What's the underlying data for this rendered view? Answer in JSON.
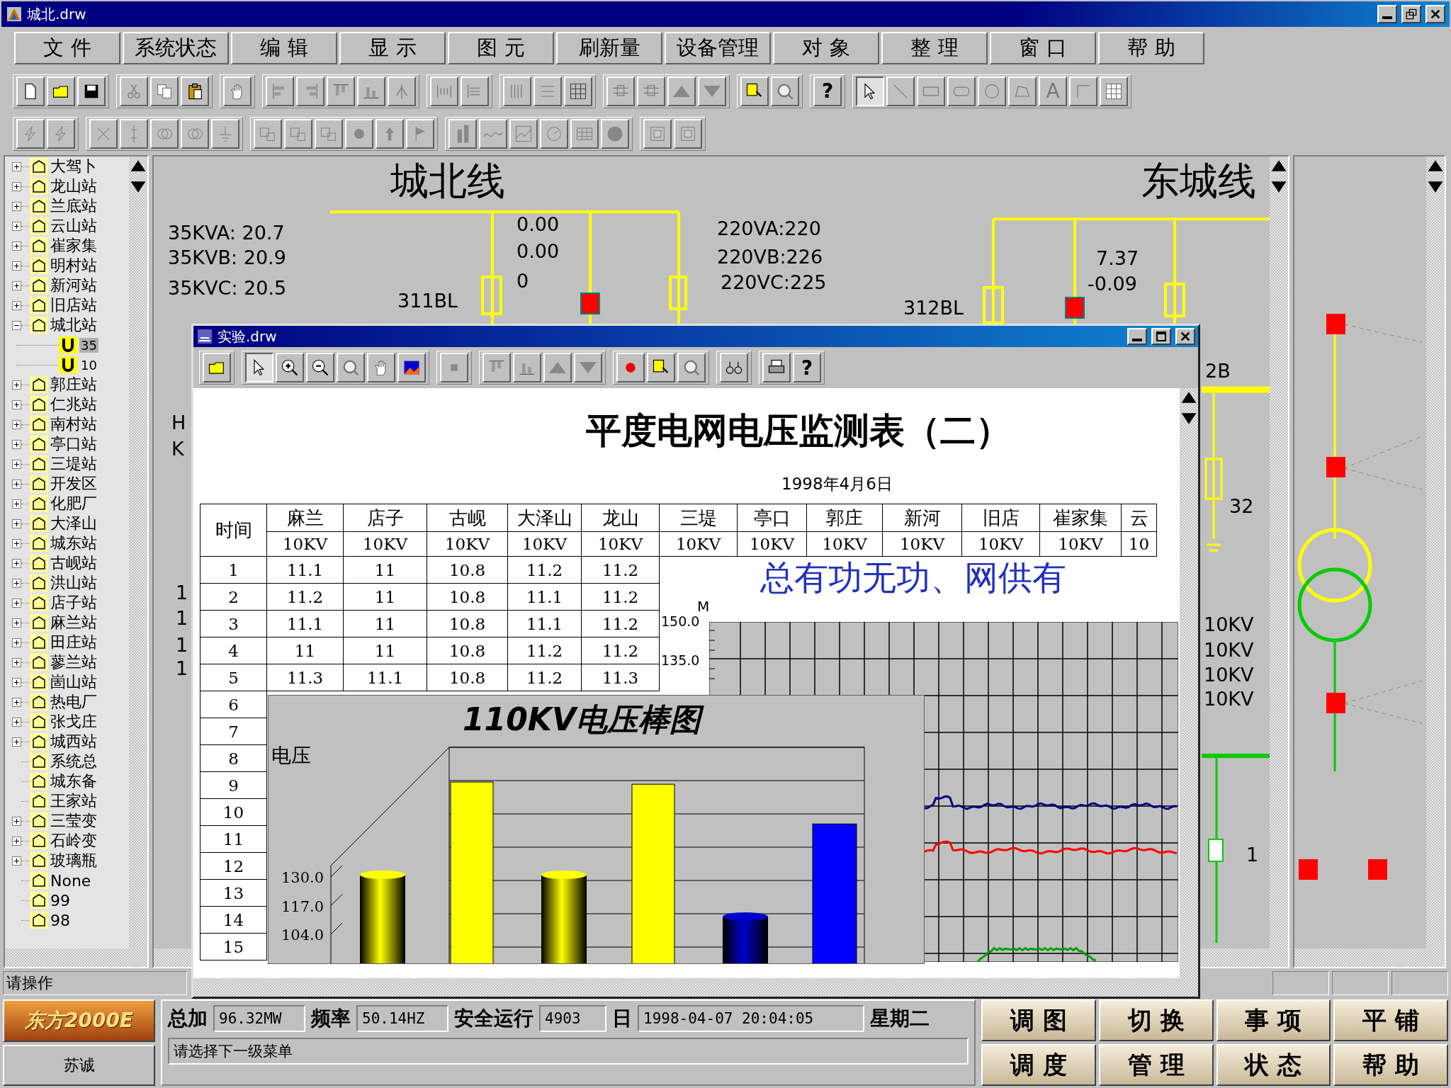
{
  "window": {
    "title": "城北.drw"
  },
  "menu": [
    "文 件",
    "系统状态",
    "编 辑",
    "显 示",
    "图 元",
    "刷新量",
    "设备管理",
    "对 象",
    "整 理",
    "窗 口",
    "帮 助"
  ],
  "toolbar": {
    "help_glyph": "?",
    "text_glyph": "A",
    "pointer_selected": true
  },
  "tree": {
    "items": [
      {
        "label": "大驾卜",
        "kind": "group",
        "expanded": false
      },
      {
        "label": "龙山站",
        "kind": "group",
        "expanded": false
      },
      {
        "label": "兰底站",
        "kind": "group",
        "expanded": false
      },
      {
        "label": "云山站",
        "kind": "group",
        "expanded": false
      },
      {
        "label": "崔家集",
        "kind": "group",
        "expanded": false
      },
      {
        "label": "明村站",
        "kind": "group",
        "expanded": false
      },
      {
        "label": "新河站",
        "kind": "group",
        "expanded": false
      },
      {
        "label": "旧店站",
        "kind": "group",
        "expanded": false
      },
      {
        "label": "城北站",
        "kind": "group",
        "expanded": true,
        "children": [
          {
            "label": "35",
            "selected": true
          },
          {
            "label": "10",
            "selected": false
          }
        ]
      },
      {
        "label": "郭庄站",
        "kind": "group",
        "expanded": false
      },
      {
        "label": "仁兆站",
        "kind": "group",
        "expanded": false
      },
      {
        "label": "南村站",
        "kind": "group",
        "expanded": false
      },
      {
        "label": "亭口站",
        "kind": "group",
        "expanded": false
      },
      {
        "label": "三堤站",
        "kind": "group",
        "expanded": false
      },
      {
        "label": "开发区",
        "kind": "group",
        "expanded": false
      },
      {
        "label": "化肥厂",
        "kind": "group",
        "expanded": false
      },
      {
        "label": "大泽山",
        "kind": "group",
        "expanded": false
      },
      {
        "label": "城东站",
        "kind": "group",
        "expanded": false
      },
      {
        "label": "古岘站",
        "kind": "group",
        "expanded": false
      },
      {
        "label": "洪山站",
        "kind": "group",
        "expanded": false
      },
      {
        "label": "店子站",
        "kind": "group",
        "expanded": false
      },
      {
        "label": "麻兰站",
        "kind": "group",
        "expanded": false
      },
      {
        "label": "田庄站",
        "kind": "group",
        "expanded": false
      },
      {
        "label": "蓼兰站",
        "kind": "group",
        "expanded": false
      },
      {
        "label": "崮山站",
        "kind": "group",
        "expanded": false
      },
      {
        "label": "热电厂",
        "kind": "group",
        "expanded": false
      },
      {
        "label": "张戈庄",
        "kind": "group",
        "expanded": false
      },
      {
        "label": "城西站",
        "kind": "group",
        "expanded": false
      },
      {
        "label": "系统总",
        "kind": "leaf"
      },
      {
        "label": "城东备",
        "kind": "leaf"
      },
      {
        "label": "王家站",
        "kind": "leaf"
      },
      {
        "label": "三莹变",
        "kind": "group",
        "expanded": false
      },
      {
        "label": "石岭变",
        "kind": "group",
        "expanded": false
      },
      {
        "label": "玻璃瓶",
        "kind": "group",
        "expanded": false
      },
      {
        "label": "None",
        "kind": "leaf"
      },
      {
        "label": "99",
        "kind": "leaf"
      },
      {
        "label": "98",
        "kind": "leaf"
      }
    ]
  },
  "diagram": {
    "titles": [
      "城北线",
      "东城线"
    ],
    "labels": [
      "35KVA: 20.7",
      "35KVB: 20.9",
      "35KVC: 20.5",
      "0.00",
      "0.00",
      "0",
      "311BL",
      "220VA:220",
      "220VB:226",
      "220VC:225",
      "7.37",
      "-0.09",
      "312BL",
      "H",
      "K",
      "1",
      "1",
      "1",
      "1",
      "2B",
      "32",
      "10KV",
      "10KV",
      "10KV",
      "10KV",
      "1"
    ]
  },
  "inner_window": {
    "title": "实验.drw",
    "toolbar": {
      "help_glyph": "?",
      "pointer_selected": true
    },
    "report": {
      "title": "平度电网电压监测表（二）",
      "date": "1998年4月6日",
      "time_header": "时间",
      "columns": [
        {
          "name": "麻兰",
          "unit": "10KV"
        },
        {
          "name": "店子",
          "unit": "10KV"
        },
        {
          "name": "古岘",
          "unit": "10KV"
        },
        {
          "name": "大泽山",
          "unit": "10KV"
        },
        {
          "name": "龙山",
          "unit": "10KV"
        },
        {
          "name": "三堤",
          "unit": "10KV"
        },
        {
          "name": "亭口",
          "unit": "10KV"
        },
        {
          "name": "郭庄",
          "unit": "10KV"
        },
        {
          "name": "新河",
          "unit": "10KV"
        },
        {
          "name": "旧店",
          "unit": "10KV"
        },
        {
          "name": "崔家集",
          "unit": "10KV"
        },
        {
          "name": "云",
          "unit": "10"
        }
      ],
      "rows": [
        {
          "time": "1",
          "values": [
            "11.1",
            "11",
            "10.8",
            "11.2",
            "11.2"
          ]
        },
        {
          "time": "2",
          "values": [
            "11.2",
            "11",
            "10.8",
            "11.1",
            "11.2"
          ]
        },
        {
          "time": "3",
          "values": [
            "11.1",
            "11",
            "10.8",
            "11.1",
            "11.2"
          ]
        },
        {
          "time": "4",
          "values": [
            "11",
            "11",
            "10.8",
            "11.2",
            "11.2"
          ]
        },
        {
          "time": "5",
          "values": [
            "11.3",
            "11.1",
            "10.8",
            "11.2",
            "11.3"
          ]
        },
        {
          "time": "6"
        },
        {
          "time": "7"
        },
        {
          "time": "8"
        },
        {
          "time": "9"
        },
        {
          "time": "10"
        },
        {
          "time": "11"
        },
        {
          "time": "12"
        },
        {
          "time": "13"
        },
        {
          "time": "14"
        },
        {
          "time": "15"
        }
      ]
    },
    "line_chart": {
      "title": "总有功无功、网供有",
      "unit": "M",
      "tick_labels": [
        "150.0",
        "135.0"
      ],
      "traces": [
        {
          "color": "#000080"
        },
        {
          "color": "#ff0000"
        },
        {
          "color": "#00a000"
        }
      ]
    },
    "bar_chart": {
      "title": "110KV电压棒图",
      "ylabel": "电压",
      "tick_labels": [
        "130.0",
        "117.0",
        "104.0"
      ],
      "bar_styles": [
        {
          "kind": "cylinder",
          "color": "#ffff00"
        },
        {
          "kind": "flat",
          "color": "#ffff00"
        },
        {
          "kind": "cylinder",
          "color": "#ffff00"
        },
        {
          "kind": "flat",
          "color": "#ffff00"
        },
        {
          "kind": "cylinder",
          "color": "#0000cc"
        },
        {
          "kind": "flat",
          "color": "#0000ff"
        }
      ]
    }
  },
  "status": "请操作",
  "brand": {
    "logo": "东方2000E",
    "name": "苏诚"
  },
  "readouts": [
    {
      "label": "总加",
      "value": "96.32MW"
    },
    {
      "label": "频率",
      "value": "50.14HZ"
    },
    {
      "label": "安全运行",
      "value": "4903"
    },
    {
      "label": "日",
      "value": "1998-04-07 20:04:05"
    }
  ],
  "weekday": "星期二",
  "prompt": "请选择下一级菜单",
  "function_buttons": [
    "调 图",
    "切 换",
    "事 项",
    "平 铺",
    "调 度",
    "管 理",
    "状 态",
    "帮 助"
  ]
}
